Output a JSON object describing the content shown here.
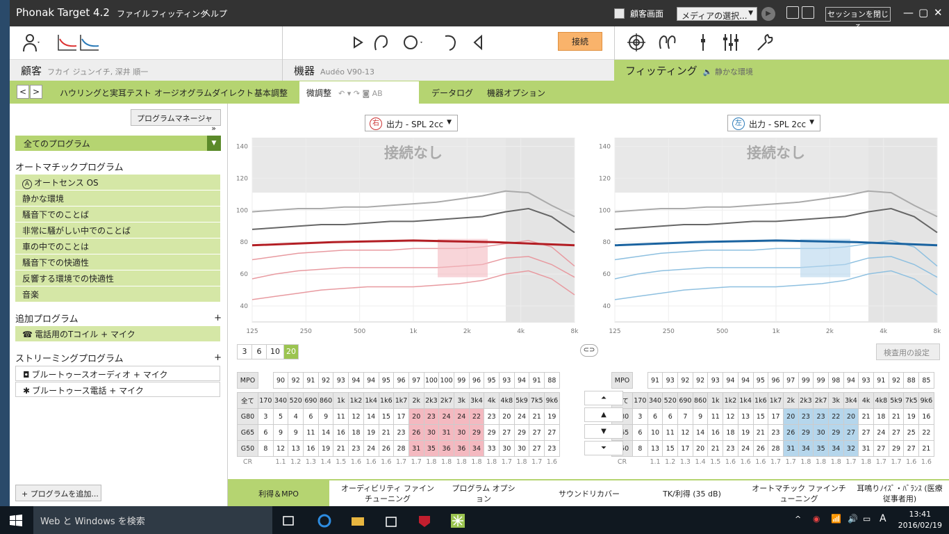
{
  "titlebar": {
    "app_title": "Phonak Target 4.2",
    "menu": [
      "ファイル",
      "フィッティング",
      "ヘルプ"
    ],
    "client_screen": "顧客画面",
    "media_select": "メディアの選択...",
    "close_session": "セッションを閉じる"
  },
  "toolbar": {
    "connect": "接続"
  },
  "panels": {
    "client_label": "顧客",
    "client_name": "フカイ ジュンイチ, 深井 順一",
    "device_label": "機器",
    "device_name": "Audéo V90-13",
    "fitting_label": "フィッティング",
    "fitting_program": "静かな環境"
  },
  "tabs": [
    "ハウリングと実耳テスト",
    "オージオグラムダイレクト",
    "基本調整",
    "微調整",
    "データログ",
    "機器オプション"
  ],
  "sidebar": {
    "program_manager": "プログラムマネージャ",
    "all_programs": "全てのプログラム",
    "auto_title": "オートマチックプログラム",
    "auto_items": [
      "オートセンス OS",
      "静かな環境",
      "騒音下でのことば",
      "非常に騒がしい中でのことば",
      "車の中でのことは",
      "騒音下での快適性",
      "反響する環境での快適性",
      "音楽"
    ],
    "extra_title": "追加プログラム",
    "extra_items": [
      "電話用のTコイル + マイク"
    ],
    "stream_title": "ストリーミングプログラム",
    "stream_items": [
      "ブルートゥースオーディオ + マイク",
      "ブルートゥース電話 + マイク"
    ],
    "add_program": "プログラムを追加..."
  },
  "charts": {
    "right_select": "出力 - SPL 2cc",
    "left_select": "出力 - SPL 2cc",
    "right_ear": "右",
    "left_ear": "左",
    "no_connection": "接続なし",
    "y_ticks": [
      "140",
      "120",
      "100",
      "80",
      "60",
      "40"
    ],
    "x_ticks": [
      "125",
      "250",
      "500",
      "1k",
      "2k",
      "4k",
      "8k"
    ]
  },
  "levels": [
    "3",
    "6",
    "10",
    "20"
  ],
  "test_settings": "検査用の設定",
  "table": {
    "freqs": [
      "全て",
      "170",
      "340",
      "520",
      "690",
      "860",
      "1k",
      "1k2",
      "1k4",
      "1k6",
      "1k7",
      "2k",
      "2k3",
      "2k7",
      "3k",
      "3k4",
      "4k",
      "4k8",
      "5k9",
      "7k5",
      "9k6"
    ],
    "right": {
      "mpo": [
        "90",
        "92",
        "91",
        "92",
        "93",
        "94",
        "94",
        "95",
        "96",
        "97",
        "100",
        "100",
        "99",
        "96",
        "95",
        "93",
        "94",
        "91",
        "88"
      ],
      "g80": [
        "3",
        "5",
        "4",
        "6",
        "9",
        "11",
        "12",
        "14",
        "15",
        "17",
        "20",
        "23",
        "24",
        "24",
        "22",
        "23",
        "20",
        "24",
        "21",
        "19"
      ],
      "g65": [
        "6",
        "9",
        "9",
        "11",
        "14",
        "16",
        "18",
        "19",
        "21",
        "23",
        "26",
        "30",
        "31",
        "30",
        "29",
        "29",
        "27",
        "29",
        "27",
        "27"
      ],
      "g50": [
        "8",
        "12",
        "13",
        "16",
        "19",
        "21",
        "23",
        "24",
        "26",
        "28",
        "31",
        "35",
        "36",
        "36",
        "34",
        "33",
        "30",
        "30",
        "27",
        "23"
      ],
      "cr": [
        "1.1",
        "1.2",
        "1.3",
        "1.4",
        "1.5",
        "1.6",
        "1.6",
        "1.6",
        "1.7",
        "1.7",
        "1.8",
        "1.8",
        "1.8",
        "1.8",
        "1.8",
        "1.7",
        "1.8",
        "1.7",
        "1.6"
      ]
    },
    "left": {
      "mpo": [
        "91",
        "93",
        "92",
        "92",
        "93",
        "94",
        "94",
        "95",
        "96",
        "97",
        "99",
        "99",
        "98",
        "94",
        "93",
        "91",
        "92",
        "88",
        "85"
      ],
      "g80": [
        "3",
        "6",
        "6",
        "7",
        "9",
        "11",
        "12",
        "13",
        "15",
        "17",
        "20",
        "23",
        "23",
        "22",
        "20",
        "21",
        "18",
        "21",
        "19",
        "16"
      ],
      "g65": [
        "6",
        "10",
        "11",
        "12",
        "14",
        "16",
        "18",
        "19",
        "21",
        "23",
        "26",
        "29",
        "30",
        "29",
        "27",
        "27",
        "24",
        "27",
        "25",
        "22"
      ],
      "g50": [
        "8",
        "13",
        "15",
        "17",
        "20",
        "21",
        "23",
        "24",
        "26",
        "28",
        "31",
        "34",
        "35",
        "34",
        "32",
        "31",
        "27",
        "29",
        "27",
        "21"
      ],
      "cr": [
        "1.1",
        "1.2",
        "1.3",
        "1.4",
        "1.5",
        "1.6",
        "1.6",
        "1.6",
        "1.7",
        "1.7",
        "1.8",
        "1.8",
        "1.8",
        "1.7",
        "1.8",
        "1.7",
        "1.7",
        "1.6",
        "1.6"
      ]
    },
    "row_labels": [
      "MPO",
      "全て",
      "G80",
      "G65",
      "G50",
      "CR"
    ]
  },
  "bottom_tabs": [
    "利得＆MPO",
    "オーディビリティ ファインチューニング",
    "プログラム オプション",
    "サウンドリカバー",
    "TK/利得 (35 dB)",
    "オートマチック ファインチューニング",
    "耳鳴りﾉｲｽﾞ・ﾊﾞﾗﾝｽ (医療従事者用)"
  ],
  "taskbar": {
    "search": "Web と Windows を検索",
    "time": "13:41",
    "date": "2016/02/19",
    "ime": "A"
  }
}
